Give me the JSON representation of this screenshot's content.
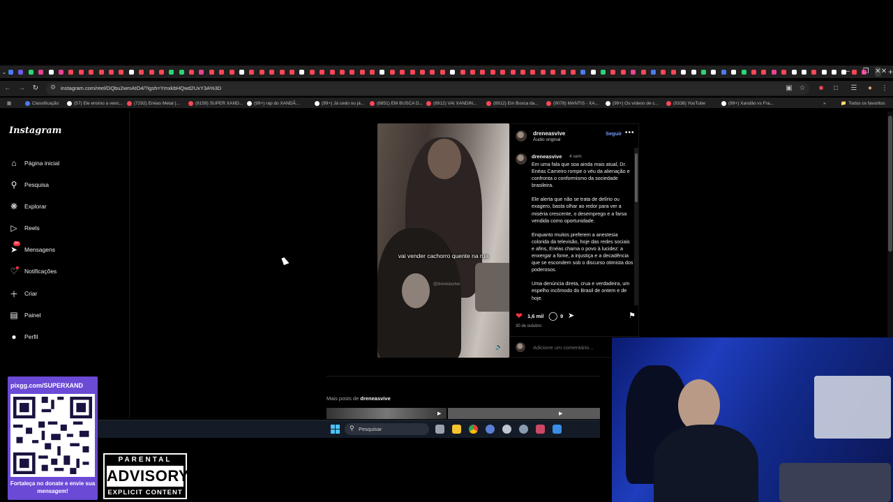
{
  "browser": {
    "url": "instagram.com/reel/DQbu2wmAtO4/?igsh=YmxkbHQwd2UxY3A%3D",
    "tab_colors": [
      "#4b7bec",
      "#6c5ce7",
      "#2ed573",
      "#e84393",
      "#ffffff",
      "#e84393",
      "#ff4757",
      "#ff4757",
      "#ff4757",
      "#ff4757",
      "#ff4757",
      "#ff4757",
      "#ffffff",
      "#ff4757",
      "#ff4757",
      "#ff4757",
      "#2ed573",
      "#2ed573",
      "#ff4757",
      "#e84393",
      "#ff4757",
      "#ff4757",
      "#ff4757",
      "#ffffff",
      "#ff4757",
      "#ff4757",
      "#ff4757",
      "#ff4757",
      "#ff4757",
      "#ffffff",
      "#ff4757",
      "#ff4757",
      "#ff4757",
      "#ff4757",
      "#ff4757",
      "#ff4757",
      "#ff4757",
      "#ffffff",
      "#ff4757",
      "#ff4757",
      "#ff4757",
      "#ff4757",
      "#ff4757",
      "#ff4757",
      "#ffffff",
      "#ff4757",
      "#ff4757",
      "#ff4757",
      "#ff4757",
      "#ff4757",
      "#ff4757",
      "#ff4757",
      "#ff4757",
      "#ff4757",
      "#ff4757",
      "#ff4757",
      "#ff4757",
      "#4b7bec",
      "#ffffff",
      "#2ed573",
      "#ff4757",
      "#ff4757",
      "#e84393",
      "#ff4757",
      "#4b7bec",
      "#ff4757",
      "#ff4757",
      "#ffffff",
      "#ffffff",
      "#2ed573",
      "#ffffff",
      "#4b7bec",
      "#ffffff",
      "#2ed573",
      "#ff4757",
      "#ff4757",
      "#e84393",
      "#ff4757",
      "#ffffff",
      "#ffffff",
      "#ff4757",
      "#ffffff",
      "#ffffff",
      "#ffffff",
      "#ff4757",
      "#e84393"
    ],
    "bookmarks": [
      {
        "label": "Classificação",
        "color": "#4b7bec"
      },
      {
        "label": "(57) Ele ensino a venc...",
        "color": "#ffffff"
      },
      {
        "label": "(7292) Enéas Metal |...",
        "color": "#ff4757"
      },
      {
        "label": "(8159) SUPER XAND...",
        "color": "#ff4757"
      },
      {
        "label": "(99+) rap do XANDÃ...",
        "color": "#ffffff"
      },
      {
        "label": "(99+) Já cedo ou já...",
        "color": "#ffffff"
      },
      {
        "label": "(8851) EM BUSCA D...",
        "color": "#ff4757"
      },
      {
        "label": "(8912) VAI XANDIN...",
        "color": "#ff4757"
      },
      {
        "label": "(8912) Em Busca da...",
        "color": "#ff4757"
      },
      {
        "label": "(9078) MANTIS - XA...",
        "color": "#ff4757"
      },
      {
        "label": "(99+) Os vídeos de c...",
        "color": "#ffffff"
      },
      {
        "label": "(9338) YouTube",
        "color": "#ff4757"
      },
      {
        "label": "(99+) Xandão vs Fra...",
        "color": "#ffffff"
      }
    ],
    "all_bookmarks": "Todos os favoritos"
  },
  "instagram": {
    "logo": "Instagram",
    "nav": [
      {
        "label": "Página inicial",
        "icon": "home-icon"
      },
      {
        "label": "Pesquisa",
        "icon": "search-icon"
      },
      {
        "label": "Explorar",
        "icon": "compass-icon"
      },
      {
        "label": "Reels",
        "icon": "reels-icon"
      },
      {
        "label": "Mensagens",
        "icon": "messenger-icon",
        "badge": "9+"
      },
      {
        "label": "Notificações",
        "icon": "heart-icon"
      },
      {
        "label": "Criar",
        "icon": "plus-icon"
      },
      {
        "label": "Painel",
        "icon": "dashboard-icon"
      },
      {
        "label": "Perfil",
        "icon": "profile-avatar"
      }
    ],
    "video": {
      "subtitle": "vai vender cachorro quente na rua",
      "watermark": "@dreneasvive"
    },
    "post": {
      "username": "dreneasvive",
      "audio": "Áudio original",
      "follow": "Seguir",
      "caption_time": "4 sem",
      "caption": [
        "Em uma fala que soa ainda mais atual, Dr. Enéas Carneiro rompe o véu da alienação e confronta o conformismo da sociedade brasileira.",
        "Ele alerta que não se trata de delírio ou exagero, basta olhar ao redor para ver a miséria crescente, o desemprego e a farsa vendida como oportunidade.",
        "Enquanto muitos preferem a anestesia colorida da televisão, hoje das redes sociais e afins, Enéas chama o povo à lucidez: a enxergar a fome, a injustiça e a decadência que se escondem sob o discurso otimista dos poderosos.",
        "Uma denúncia direta, crua e verdadeira, um espelho incômodo do Brasil de ontem e de hoje."
      ],
      "likes": "1,6 mil",
      "comments": "9",
      "date": "30 de outubro",
      "comment_placeholder": "Adicione um comentário..."
    },
    "more_posts_prefix": "Mais posts de",
    "more_posts_user": "dreneasvive"
  },
  "taskbar": {
    "search": "Pesquisar"
  },
  "overlay": {
    "qr_url": "pixgg.com/SUPERXAND",
    "qr_message": "Fortaleça no donate e envie sua mensagem!",
    "advisory_top": "PARENTAL",
    "advisory_mid": "ADVISORY",
    "advisory_bottom": "EXPLICIT CONTENT"
  }
}
